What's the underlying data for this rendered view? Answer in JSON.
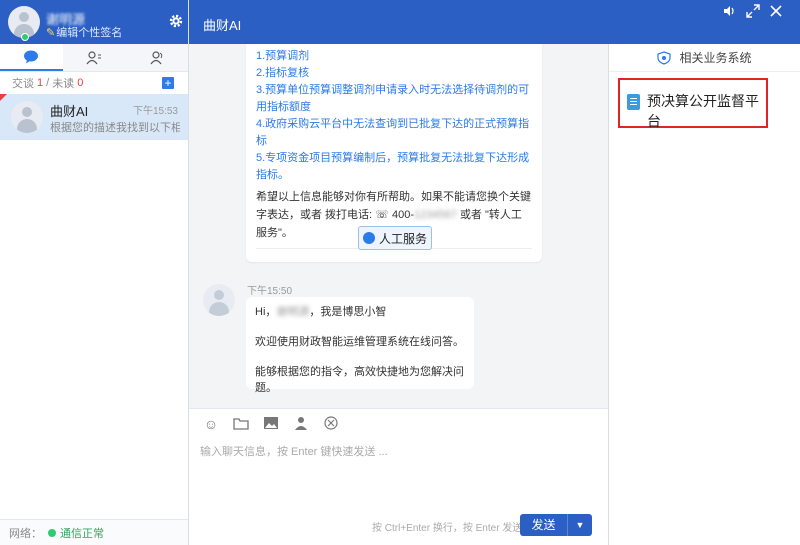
{
  "user": {
    "name": "谢明源",
    "signature": "编辑个性签名",
    "status": "online"
  },
  "left": {
    "stats": {
      "chat_label": "交谈",
      "chat_count": "1",
      "unread_label": "未读",
      "unread_count": "0"
    },
    "conversation": {
      "name": "曲财AI",
      "time": "下午15:53",
      "preview": "根据您的描述我找到以下相..."
    },
    "network": {
      "label": "网络：",
      "status": "通信正常"
    }
  },
  "header": {
    "title": "曲财AI"
  },
  "messages": {
    "links": [
      "1.预算调剂",
      "2.指标复核",
      "3.预算单位预算调整调剂申请录入时无法选择待调剂的可用指标额度",
      "4.政府采购云平台中无法查询到已批复下达的正式预算指标",
      "5.专项资金项目预算编制后，预算批复无法批复下达形成指标。"
    ],
    "note_prefix": "希望以上信息能够对你有所帮助。如果不能请您换个关键字表达，或者 拨打电话:",
    "phone": "400-",
    "phone_blur": "1234567",
    "note_suffix": "或者 \"转人工服务\"。",
    "human_button": "人工服务",
    "time": "下午15:50",
    "greeting_prefix": "Hi，",
    "greeting_name": "谢明源",
    "greeting_suffix": "，我是博思小智",
    "welcome": "欢迎使用财政智能运维管理系统在线问答。",
    "ability": "能够根据您的指令，高效快捷地为您解决问题。"
  },
  "input": {
    "placeholder": "输入聊天信息，按 Enter 键快速发送 ...",
    "hint": "按 Ctrl+Enter 换行，按 Enter 发送",
    "send_label": "发送"
  },
  "right": {
    "title": "相关业务系统",
    "platform": "预决算公开监督平台"
  },
  "colors": {
    "brand": "#2b5fc3",
    "link": "#2b7be8",
    "alert": "#e02424",
    "online": "#2ecc71"
  }
}
